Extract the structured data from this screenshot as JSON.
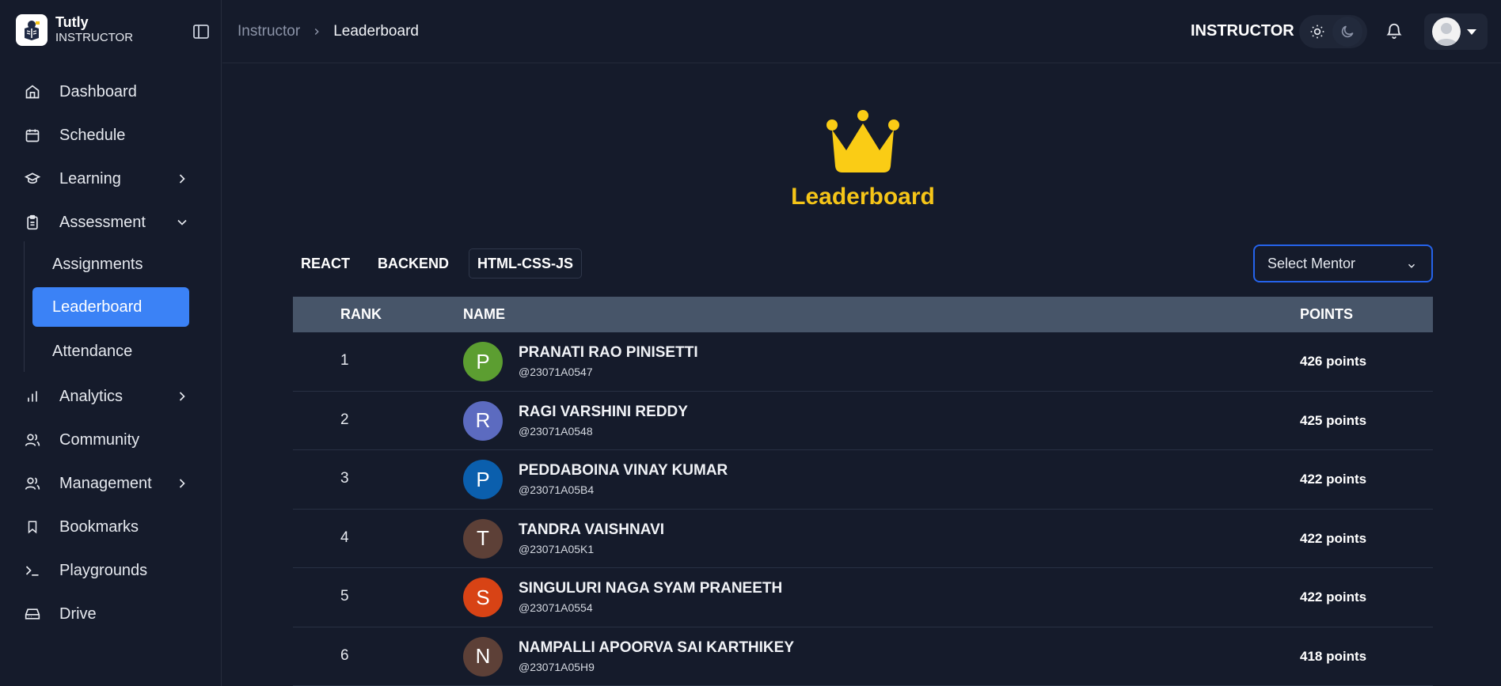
{
  "brand": {
    "name": "Tutly",
    "role": "INSTRUCTOR"
  },
  "sidebar": {
    "items": [
      {
        "label": "Dashboard",
        "icon": "home-icon"
      },
      {
        "label": "Schedule",
        "icon": "calendar-icon"
      },
      {
        "label": "Learning",
        "icon": "graduation-cap-icon",
        "chevron": "right"
      },
      {
        "label": "Assessment",
        "icon": "clipboard-icon",
        "chevron": "down"
      },
      {
        "label": "Analytics",
        "icon": "bar-chart-icon",
        "chevron": "right"
      },
      {
        "label": "Community",
        "icon": "users-icon"
      },
      {
        "label": "Management",
        "icon": "user-cog-icon",
        "chevron": "right"
      },
      {
        "label": "Bookmarks",
        "icon": "bookmark-icon"
      },
      {
        "label": "Playgrounds",
        "icon": "terminal-icon"
      },
      {
        "label": "Drive",
        "icon": "hard-drive-icon"
      }
    ],
    "sub_items": [
      {
        "label": "Assignments",
        "active": false
      },
      {
        "label": "Leaderboard",
        "active": true
      },
      {
        "label": "Attendance",
        "active": false
      }
    ]
  },
  "header": {
    "breadcrumb": [
      "Instructor",
      "Leaderboard"
    ],
    "role_label": "INSTRUCTOR"
  },
  "main": {
    "title": "Leaderboard",
    "tabs": [
      "REACT",
      "BACKEND",
      "HTML-CSS-JS"
    ],
    "active_tab": "HTML-CSS-JS",
    "mentor_select": {
      "placeholder": "Select Mentor"
    },
    "table": {
      "headers": {
        "rank": "RANK",
        "name": "NAME",
        "points": "POINTS"
      },
      "rows": [
        {
          "rank": "1",
          "initial": "P",
          "name": "PRANATI RAO PINISETTI",
          "handle": "@23071A0547",
          "points": "426 points",
          "color": "#5c9e31"
        },
        {
          "rank": "2",
          "initial": "R",
          "name": "RAGI VARSHINI REDDY",
          "handle": "@23071A0548",
          "points": "425 points",
          "color": "#5c6bc0"
        },
        {
          "rank": "3",
          "initial": "P",
          "name": "PEDDABOINA VINAY KUMAR",
          "handle": "@23071A05B4",
          "points": "422 points",
          "color": "#0b5fad"
        },
        {
          "rank": "4",
          "initial": "T",
          "name": "TANDRA VAISHNAVI",
          "handle": "@23071A05K1",
          "points": "422 points",
          "color": "#5d4037"
        },
        {
          "rank": "5",
          "initial": "S",
          "name": "SINGULURI NAGA SYAM PRANEETH",
          "handle": "@23071A0554",
          "points": "422 points",
          "color": "#d84315"
        },
        {
          "rank": "6",
          "initial": "N",
          "name": "NAMPALLI APOORVA SAI KARTHIKEY",
          "handle": "@23071A05H9",
          "points": "418 points",
          "color": "#5d4037"
        }
      ]
    }
  },
  "colors": {
    "accent": "#3b82f6",
    "crown": "#f5c518",
    "table_header": "#475569"
  }
}
